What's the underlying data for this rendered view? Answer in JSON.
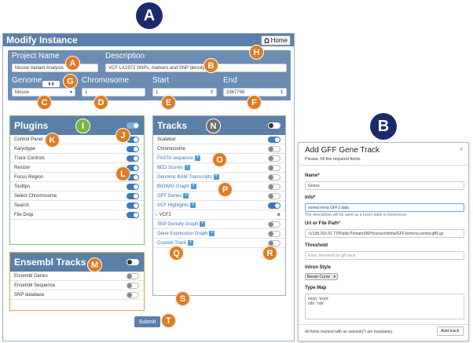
{
  "labels": {
    "A": "A",
    "B": "B"
  },
  "main": {
    "title": "Modify Instance",
    "home_label": "Home",
    "project_name_label": "Project Name",
    "project_name_value": "Mouse Variant Analysis",
    "description_label": "Description",
    "description_value": "VCF LA1972 SNPs, markers and SNP density",
    "genome_label": "Genome",
    "genome_value": "Mouse",
    "chromosome_label": "Chromosome",
    "chromosome_value": "1",
    "start_label": "Start",
    "start_value": "1",
    "end_label": "End",
    "end_value": "3367798",
    "submit_label": "Submit"
  },
  "plugins": {
    "title": "Plugins",
    "header_toggle_on": true,
    "items": [
      {
        "label": "Control Panel",
        "on": true
      },
      {
        "label": "Karyotype",
        "on": true
      },
      {
        "label": "Track Controls",
        "on": true
      },
      {
        "label": "Resizer",
        "on": true
      },
      {
        "label": "Focus Region",
        "on": true
      },
      {
        "label": "Tooltips",
        "on": true
      },
      {
        "label": "Select Chromosome",
        "on": true
      },
      {
        "label": "Search",
        "on": true
      },
      {
        "label": "File Drop",
        "on": true
      }
    ]
  },
  "ensembl": {
    "title": "Ensembl Tracks",
    "header_toggle_on": false,
    "items": [
      {
        "label": "Ensembl Genes",
        "on": false
      },
      {
        "label": "Ensembl Sequence",
        "on": false
      },
      {
        "label": "SNP database",
        "on": false
      }
    ]
  },
  "tracks": {
    "title": "Tracks",
    "header_toggle_on": false,
    "items": [
      {
        "label": "Scalebar",
        "on": true,
        "link": false,
        "plus": false
      },
      {
        "label": "Chromosome",
        "on": false,
        "link": false,
        "plus": false
      },
      {
        "label": "FASTA sequence",
        "on": false,
        "link": true,
        "plus": true
      },
      {
        "label": "BED Scores",
        "on": false,
        "link": true,
        "plus": true
      },
      {
        "label": "Genomic BAM Transcripts",
        "on": false,
        "link": true,
        "plus": true
      },
      {
        "label": "BIGWIG Graph",
        "on": false,
        "link": true,
        "plus": true
      },
      {
        "label": "GFF Genes",
        "on": false,
        "link": true,
        "plus": true
      },
      {
        "label": "VCF Highlights",
        "on": true,
        "link": true,
        "plus": true
      },
      {
        "label": "VCF2",
        "on": null,
        "link": false,
        "plus": false,
        "close": "×"
      },
      {
        "label": "SNP Density Graph",
        "on": false,
        "link": true,
        "plus": true
      },
      {
        "label": "Gene Expression Graph",
        "on": false,
        "link": true,
        "plus": true
      },
      {
        "label": "Custom Track",
        "on": false,
        "link": true,
        "plus": true
      }
    ]
  },
  "badges": {
    "A": "A",
    "B": "B",
    "C": "C",
    "D": "D",
    "E": "E",
    "F": "F",
    "G": "G",
    "H": "H",
    "I": "I",
    "J": "J",
    "K": "K",
    "L": "L",
    "M": "M",
    "N": "N",
    "O": "O",
    "P": "P",
    "Q": "Q",
    "R": "R",
    "S": "S",
    "T": "T"
  },
  "modal": {
    "title": "Add GFF Gene Track",
    "subtitle": "Please, fill the required fields.",
    "close": "×",
    "name_label": "Name*",
    "name_value": "Genes",
    "info_label": "Info*",
    "info_value": "sorted mrna GFF3 data",
    "info_help": "The description will be used as a hover label in Genoverse",
    "url_label": "Url or File Path*",
    "url_value": "<//138.250.31.77/Public/TomatoSNP/tracks/chiltria/GFF3s/mrna.sorted.gff3.gz",
    "threshold_label": "Threshold",
    "threshold_placeholder": "Enter threshold for gff track",
    "intron_label": "Intron Style",
    "intron_value": "Bezier Curve",
    "typemap_label": "Type Map",
    "typemap_line1": "exon: 'exon',",
    "typemap_line2": "cds: 'cds'",
    "footer_note": "All fields marked with an asterisk(*) are mandatory.",
    "add_track_label": "Add track"
  }
}
